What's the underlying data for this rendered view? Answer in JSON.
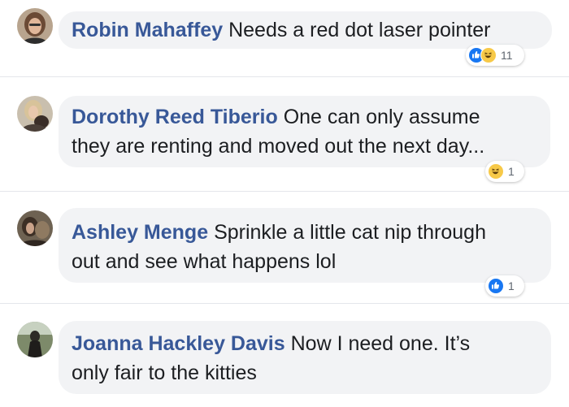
{
  "comments": [
    {
      "author": "Robin Mahaffey",
      "text_lines": [
        "Needs a red dot laser pointer"
      ],
      "reactions": [
        "like",
        "haha"
      ],
      "reaction_count": "11"
    },
    {
      "author": "Dorothy Reed Tiberio",
      "text_lines": [
        "One can only assume",
        "they are renting and moved out the next day..."
      ],
      "reactions": [
        "haha"
      ],
      "reaction_count": "1"
    },
    {
      "author": "Ashley Menge",
      "text_lines": [
        "Sprinkle a little cat nip through",
        "out and see what happens lol"
      ],
      "reactions": [
        "like"
      ],
      "reaction_count": "1"
    },
    {
      "author": "Joanna Hackley Davis",
      "text_lines": [
        "Now I need one. It’s",
        "only fair to the kitties"
      ],
      "reactions": [],
      "reaction_count": ""
    }
  ],
  "colors": {
    "author_name": "#385898",
    "bubble_bg": "#f2f3f5",
    "like": "#1877f2",
    "haha": "#f7c948"
  }
}
